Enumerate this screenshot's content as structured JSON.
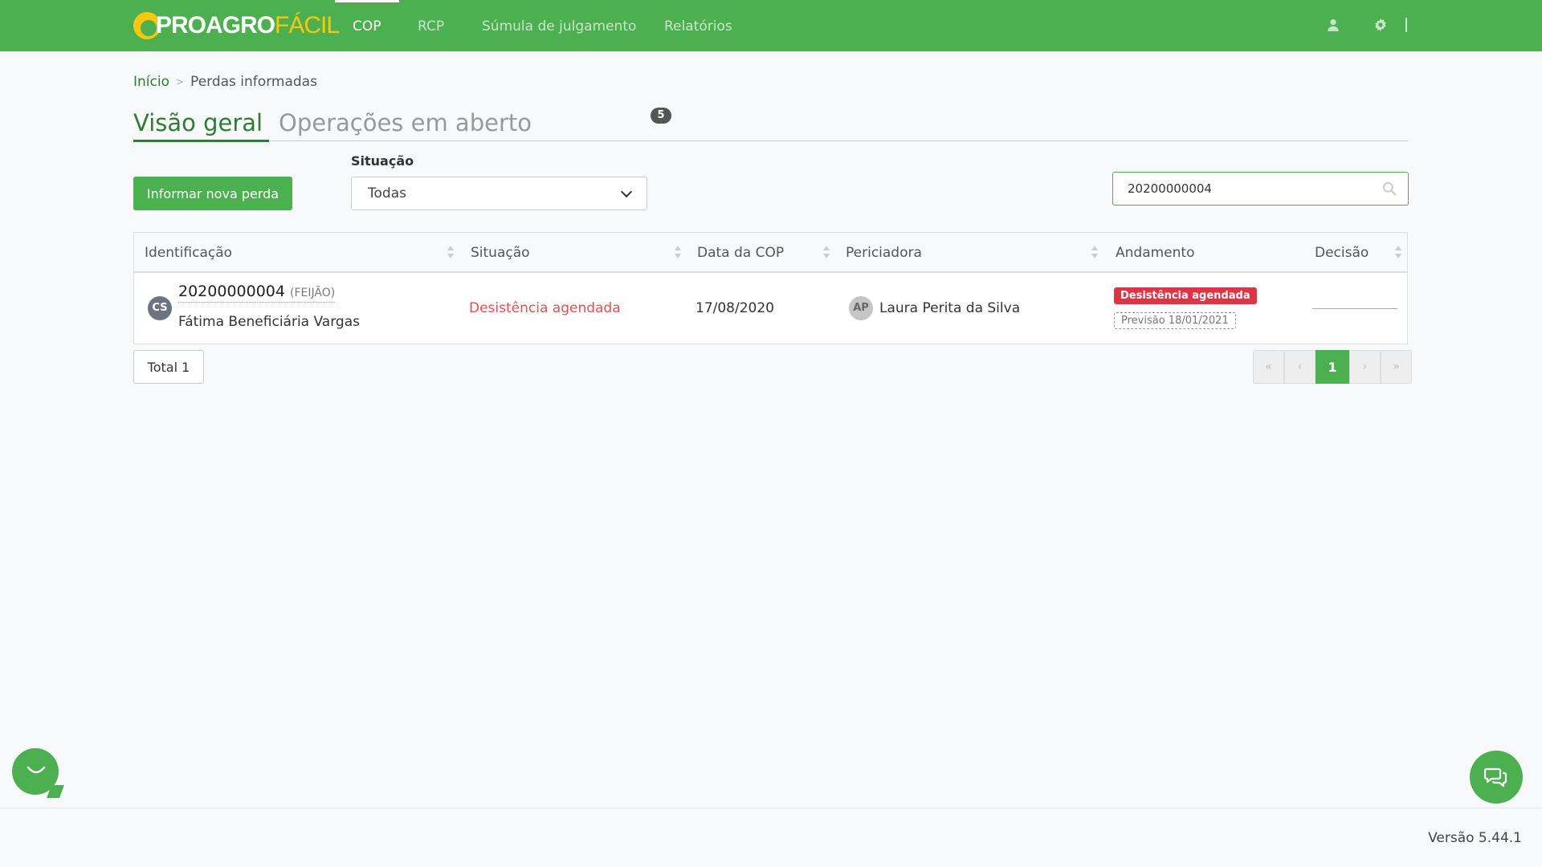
{
  "brand": {
    "logo_main": "PROAGRO",
    "logo_accent": "FÁCIL",
    "accent_color": "#4caf50",
    "logo_yellow": "#f9c80e"
  },
  "nav": {
    "items": [
      {
        "label": "COP",
        "active": true
      },
      {
        "label": "RCP"
      },
      {
        "label": "Súmula de julgamento"
      },
      {
        "label": "Relatórios"
      }
    ],
    "icons": [
      "user-icon",
      "gear-icon"
    ]
  },
  "breadcrumb": {
    "home": "Início",
    "current": "Perdas informadas"
  },
  "tabs": [
    {
      "label": "Visão geral",
      "active": true
    },
    {
      "label": "Operações em aberto",
      "badge": "5"
    }
  ],
  "toolbar": {
    "new_loss_label": "Informar nova perda",
    "filter_label": "Situação",
    "filter_value": "Todas",
    "search_value": "20200000004"
  },
  "table": {
    "headers": [
      "Identificação",
      "Situação",
      "Data da COP",
      "Periciadora",
      "Andamento",
      "Decisão"
    ],
    "rows": [
      {
        "avatar": "CS",
        "id": "20200000004",
        "crop": "(FEIJÃO)",
        "beneficiary": "Fátima Beneficiária Vargas",
        "status": "Desistência agendada",
        "date": "17/08/2020",
        "expert_avatar": "AP",
        "expert": "Laura Perita da Silva",
        "progress_badge": "Desistência agendada",
        "progress_forecast": "Previsão 18/01/2021"
      }
    ]
  },
  "footer_bar": {
    "total": "Total 1",
    "pagination": {
      "first": "«",
      "prev": "‹",
      "current": "1",
      "next": "›",
      "last": "»"
    }
  },
  "footer": {
    "version": "Versão 5.44.1"
  }
}
